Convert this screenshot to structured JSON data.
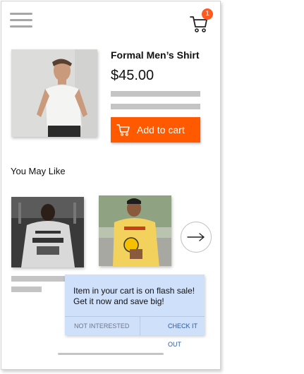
{
  "header": {
    "menu_icon": "hamburger-menu-icon",
    "cart_icon": "shopping-cart-icon",
    "cart_count": "1"
  },
  "product": {
    "name": "Formal Men’s Shirt",
    "price": "$45.00",
    "add_to_cart_label": "Add to cart"
  },
  "recommendations": {
    "title": "You May Like",
    "next_icon": "arrow-right-icon"
  },
  "toast": {
    "message": "Item in your cart is  on flash sale! Get it now and save big!",
    "dismiss_label": "NOT INTERESTED",
    "action_label": "CHECK IT OUT"
  },
  "colors": {
    "accent": "#ff5a00",
    "badge": "#ff5a1f",
    "toast_bg": "#cfe0fb",
    "toast_action": "#2a5a9c",
    "skeleton": "#c4c4c4"
  }
}
